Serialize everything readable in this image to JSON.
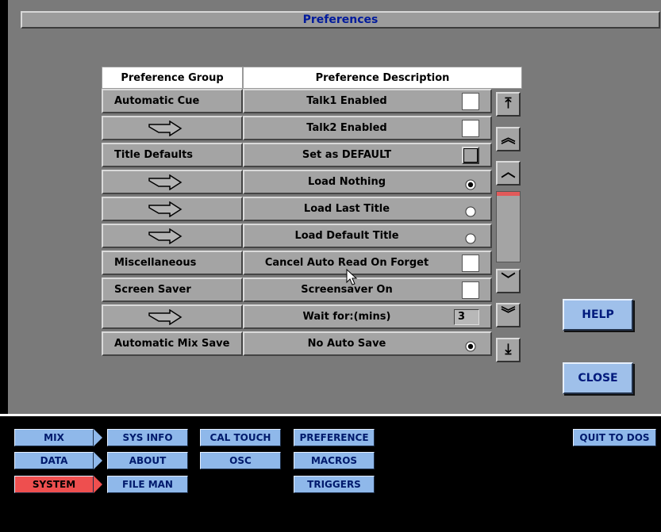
{
  "window": {
    "title": "Preferences"
  },
  "table": {
    "headers": {
      "group": "Preference Group",
      "description": "Preference Description"
    },
    "rows": [
      {
        "group": "Automatic Cue",
        "group_icon": "",
        "description": "Talk1 Enabled",
        "control": "checkbox",
        "checked": false
      },
      {
        "group": "",
        "group_icon": "continuation-arrow-icon",
        "description": "Talk2 Enabled",
        "control": "checkbox",
        "checked": false
      },
      {
        "group": "Title Defaults",
        "group_icon": "",
        "description": "Set as DEFAULT",
        "control": "button",
        "checked": false
      },
      {
        "group": "",
        "group_icon": "continuation-arrow-icon",
        "description": "Load Nothing",
        "control": "radio",
        "checked": true
      },
      {
        "group": "",
        "group_icon": "continuation-arrow-icon",
        "description": "Load Last Title",
        "control": "radio",
        "checked": false
      },
      {
        "group": "",
        "group_icon": "continuation-arrow-icon",
        "description": "Load Default Title",
        "control": "radio",
        "checked": false
      },
      {
        "group": "Miscellaneous",
        "group_icon": "",
        "description": "Cancel Auto Read On Forget",
        "control": "checkbox",
        "checked": false
      },
      {
        "group": "Screen Saver",
        "group_icon": "",
        "description": "Screensaver On",
        "control": "checkbox",
        "checked": false
      },
      {
        "group": "",
        "group_icon": "continuation-arrow-icon",
        "description": "Wait for:(mins)",
        "control": "number",
        "value": "3"
      },
      {
        "group": "Automatic Mix Save",
        "group_icon": "",
        "description": "No Auto Save",
        "control": "radio",
        "checked": true
      }
    ]
  },
  "scrollbar": {
    "icons": [
      "scroll-top-icon",
      "scroll-page-up-icon",
      "scroll-line-up-icon",
      "scroll-line-down-icon",
      "scroll-page-down-icon",
      "scroll-bottom-icon"
    ],
    "glyphs": {
      "top": "⤒",
      "page_up": "︽",
      "up": "︿",
      "down": "﹀",
      "page_down": "︾",
      "bottom": "⤓"
    }
  },
  "dialog_buttons": {
    "help": "HELP",
    "close": "CLOSE"
  },
  "nav": {
    "tabs": [
      {
        "label": "MIX",
        "active": false
      },
      {
        "label": "DATA",
        "active": false
      },
      {
        "label": "SYSTEM",
        "active": true
      }
    ],
    "buttons": {
      "sys_info": "SYS INFO",
      "about": "ABOUT",
      "file_man": "FILE MAN",
      "cal_touch": "CAL TOUCH",
      "osc": "OSC",
      "preference": "PREFERENCE",
      "macros": "MACROS",
      "triggers": "TRIGGERS",
      "quit": "QUIT TO DOS"
    }
  },
  "colors": {
    "panel": "#7a7a7a",
    "button_blue": "#8fb8ea",
    "active_red": "#ee4f4f",
    "title_text": "#001a9c"
  }
}
